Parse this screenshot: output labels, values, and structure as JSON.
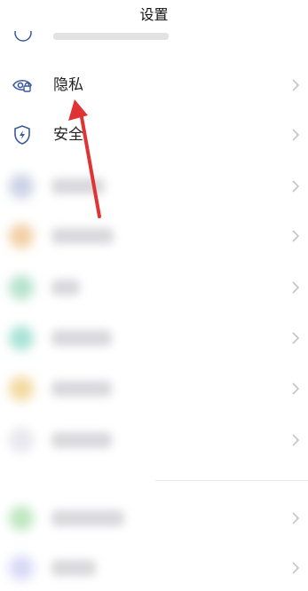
{
  "header": {
    "title": "设置"
  },
  "rows": [
    {
      "label": "隐私",
      "icon": "privacy-eye-lock-icon"
    },
    {
      "label": "安全",
      "icon": "security-shield-icon"
    }
  ],
  "blurred_rows": [
    {
      "icon_color": "#cbd2e6"
    },
    {
      "icon_color": "#f2cfa6"
    },
    {
      "icon_color": "#b6e3cc"
    },
    {
      "icon_color": "#a9e3d6"
    },
    {
      "icon_color": "#f3d9a0"
    },
    {
      "icon_color": "#e7e7ee"
    },
    {
      "icon_color": "#bfe6bf"
    },
    {
      "icon_color": "#d7d9f5"
    }
  ],
  "colors": {
    "accent_icon": "#3a5a9a",
    "annotation_arrow": "#e03434",
    "chevron": "#c4c4c4"
  }
}
